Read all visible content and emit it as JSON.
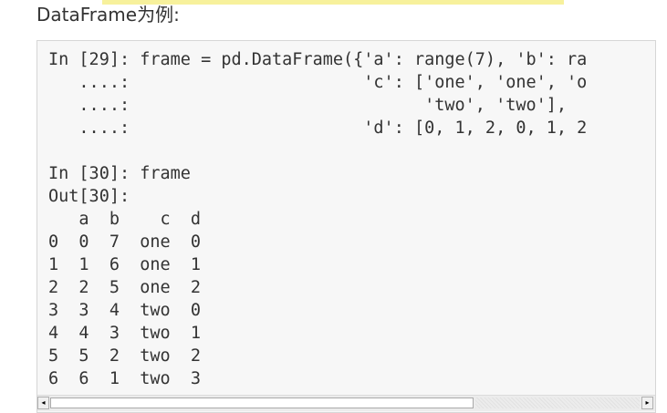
{
  "heading": "DataFrame为例:",
  "code_lines": [
    "In [29]: frame = pd.DataFrame({'a': range(7), 'b': ra",
    "   ....:                       'c': ['one', 'one', 'o",
    "   ....:                             'two', 'two'],",
    "   ....:                       'd': [0, 1, 2, 0, 1, 2",
    "",
    "In [30]: frame",
    "Out[30]:",
    "   a  b    c  d",
    "0  0  7  one  0",
    "1  1  6  one  1",
    "2  2  5  one  2",
    "3  3  4  two  0",
    "4  4  3  two  1",
    "5  5  2  two  2",
    "6  6  1  two  3"
  ],
  "colors": {
    "highlight": "#f7f19c",
    "code_background": "#f7f7f7",
    "text": "#333333"
  },
  "icons": {
    "scroll_left": "scroll-left-arrow-icon",
    "scroll_right": "scroll-right-arrow-icon"
  }
}
